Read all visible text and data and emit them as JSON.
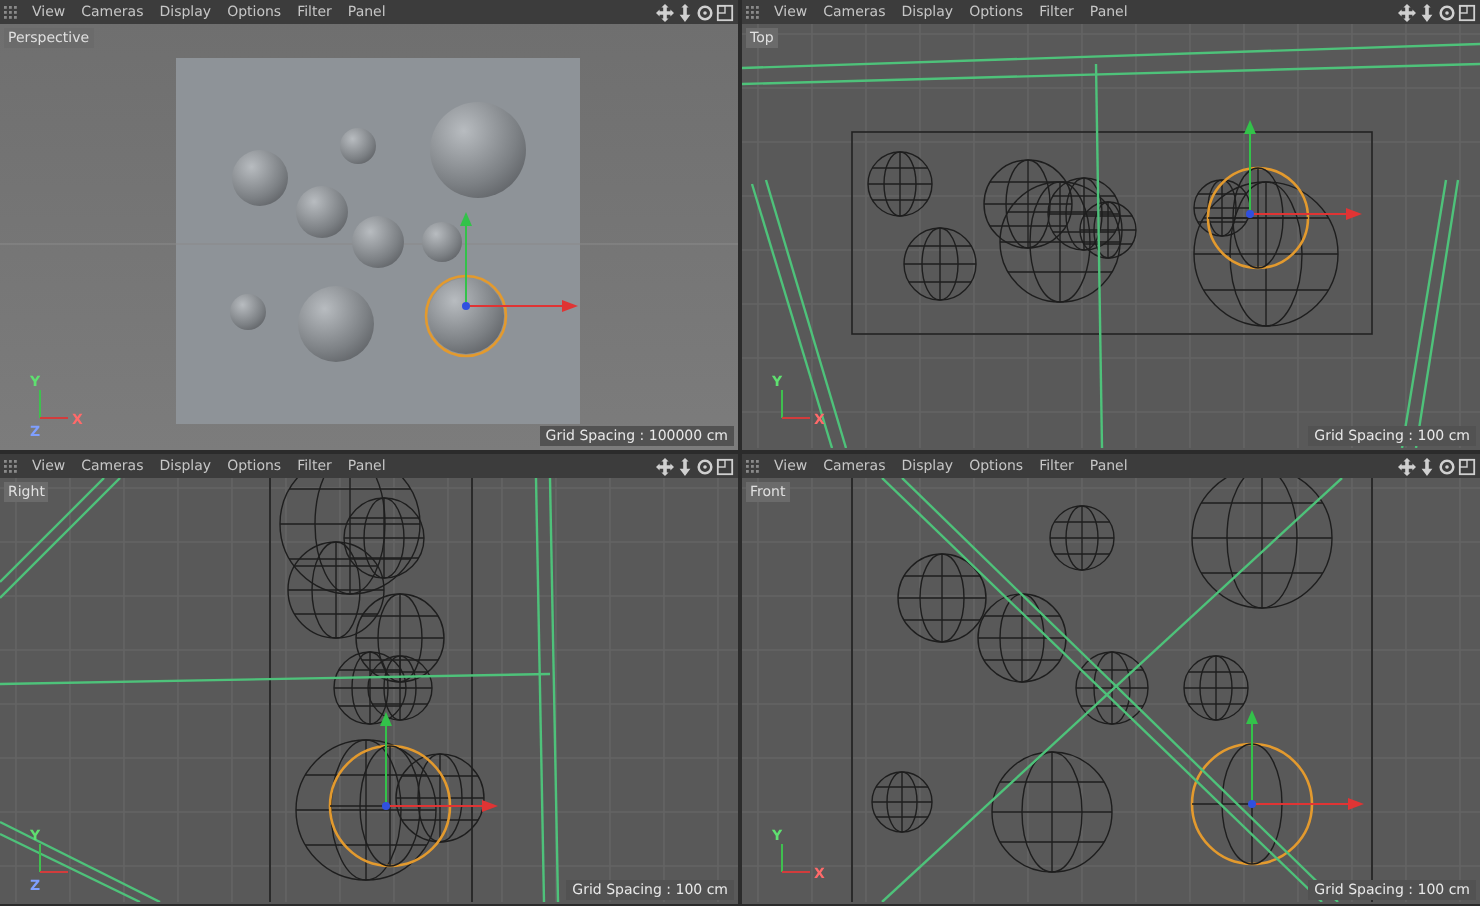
{
  "viewports": [
    {
      "kind": "perspective",
      "menu": [
        "View",
        "Cameras",
        "Display",
        "Options",
        "Filter",
        "Panel"
      ],
      "label": "Perspective",
      "grid_spacing": "Grid Spacing : 100000 cm",
      "axes": [
        {
          "kind": "x",
          "label": "X"
        },
        {
          "kind": "y",
          "label": "Y"
        },
        {
          "kind": "z",
          "label": "Z"
        }
      ]
    },
    {
      "kind": "top",
      "menu": [
        "View",
        "Cameras",
        "Display",
        "Options",
        "Filter",
        "Panel"
      ],
      "label": "Top",
      "grid_spacing": "Grid Spacing : 100 cm",
      "axes": [
        {
          "kind": "x",
          "label": "X"
        },
        {
          "kind": "y",
          "label": "Y"
        }
      ]
    },
    {
      "kind": "right",
      "menu": [
        "View",
        "Cameras",
        "Display",
        "Options",
        "Filter",
        "Panel"
      ],
      "label": "Right",
      "grid_spacing": "Grid Spacing : 100 cm",
      "axes": [
        {
          "kind": "y",
          "label": "Y"
        },
        {
          "kind": "z",
          "label": "Z"
        }
      ]
    },
    {
      "kind": "front",
      "menu": [
        "View",
        "Cameras",
        "Display",
        "Options",
        "Filter",
        "Panel"
      ],
      "label": "Front",
      "grid_spacing": "Grid Spacing : 100 cm",
      "axes": [
        {
          "kind": "x",
          "label": "X"
        },
        {
          "kind": "y",
          "label": "Y"
        }
      ]
    }
  ]
}
